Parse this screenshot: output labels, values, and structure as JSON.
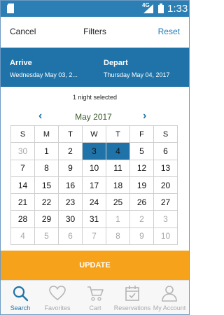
{
  "status_bar": {
    "network": "4G",
    "time": "1:33"
  },
  "header": {
    "cancel_label": "Cancel",
    "title": "Filters",
    "reset_label": "Reset"
  },
  "dates": {
    "arrive_label": "Arrive",
    "arrive_value": "Wednesday May 03, 2...",
    "depart_label": "Depart",
    "depart_value": "Thursday May 04, 2017"
  },
  "nights_text": "1 night selected",
  "calendar": {
    "month_label": "May 2017",
    "prev_glyph": "‹",
    "next_glyph": "›",
    "weekdays": [
      "S",
      "M",
      "T",
      "W",
      "T",
      "F",
      "S"
    ],
    "weeks": [
      [
        {
          "d": "30",
          "m": true
        },
        {
          "d": "1"
        },
        {
          "d": "2"
        },
        {
          "d": "3",
          "s": true
        },
        {
          "d": "4",
          "s": true
        },
        {
          "d": "5"
        },
        {
          "d": "6"
        }
      ],
      [
        {
          "d": "7"
        },
        {
          "d": "8"
        },
        {
          "d": "9"
        },
        {
          "d": "10"
        },
        {
          "d": "11"
        },
        {
          "d": "12"
        },
        {
          "d": "13"
        }
      ],
      [
        {
          "d": "14"
        },
        {
          "d": "15"
        },
        {
          "d": "16"
        },
        {
          "d": "17"
        },
        {
          "d": "18"
        },
        {
          "d": "19"
        },
        {
          "d": "20"
        }
      ],
      [
        {
          "d": "21"
        },
        {
          "d": "22"
        },
        {
          "d": "23"
        },
        {
          "d": "24"
        },
        {
          "d": "25"
        },
        {
          "d": "26"
        },
        {
          "d": "27"
        }
      ],
      [
        {
          "d": "28"
        },
        {
          "d": "29"
        },
        {
          "d": "30"
        },
        {
          "d": "31"
        },
        {
          "d": "1",
          "m": true
        },
        {
          "d": "2",
          "m": true
        },
        {
          "d": "3",
          "m": true
        }
      ],
      [
        {
          "d": "4",
          "m": true
        },
        {
          "d": "5",
          "m": true
        },
        {
          "d": "6",
          "m": true
        },
        {
          "d": "7",
          "m": true
        },
        {
          "d": "8",
          "m": true
        },
        {
          "d": "9",
          "m": true
        },
        {
          "d": "10",
          "m": true
        }
      ]
    ],
    "selected_color": "#1f73a8"
  },
  "update_label": "UPDATE",
  "tabs": [
    {
      "label": "Search",
      "icon": "search-icon",
      "active": true
    },
    {
      "label": "Favorites",
      "icon": "heart-icon",
      "active": false
    },
    {
      "label": "Cart",
      "icon": "cart-icon",
      "active": false
    },
    {
      "label": "Reservations",
      "icon": "calendar-check-icon",
      "active": false
    },
    {
      "label": "My Account",
      "icon": "person-icon",
      "active": false
    }
  ],
  "colors": {
    "status_bar": "#2b7fb4",
    "header_band": "#1f73a8",
    "accent": "#1f73a8",
    "update_button": "#f7a21b",
    "tab_inactive": "#a9a9a9"
  }
}
